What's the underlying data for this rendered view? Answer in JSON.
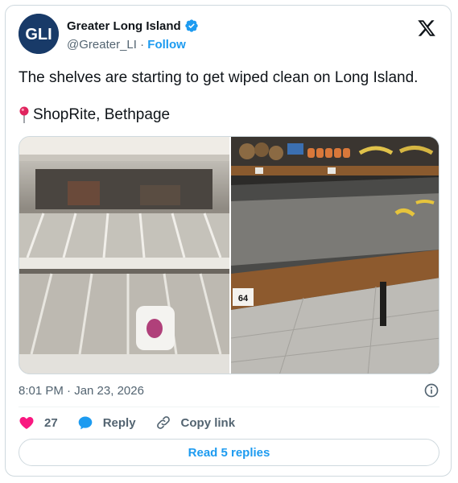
{
  "account": {
    "name": "Greater Long Island",
    "handle": "@Greater_LI",
    "separator": " · ",
    "follow_label": "Follow",
    "avatar_text": "GLI",
    "icons": {
      "verified": "verified-badge-icon",
      "platform": "x-logo-icon"
    }
  },
  "tweet": {
    "text": "The shelves are starting to get wiped clean on Long Island.",
    "location_icon": "round-pushpin-icon",
    "location": "ShopRite, Bethpage",
    "photos": [
      {
        "description_icon": "empty-shelves-photo"
      },
      {
        "description_icon": "empty-produce-bins-photo",
        "sign_text": "64"
      }
    ],
    "timestamp": "8:01 PM · Jan 23, 2026"
  },
  "actions": {
    "like_count": "27",
    "reply_label": "Reply",
    "copy_link_label": "Copy link",
    "read_replies_label": "Read 5 replies"
  },
  "colors": {
    "accent": "#1d9bf0",
    "like": "#f91880",
    "text": "#0f1419",
    "muted": "#536471",
    "border": "#cfd9de"
  }
}
